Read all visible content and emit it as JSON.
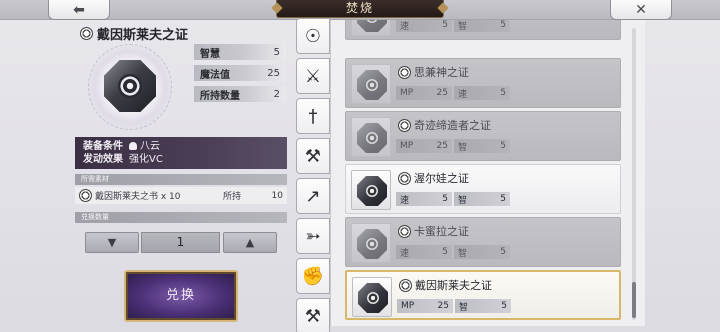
{
  "header": {
    "title": "焚烧",
    "back_icon": "back-arrow-icon",
    "close_icon": "close-x-icon"
  },
  "detail": {
    "item_name": "戴因斯莱夫之证",
    "stats": [
      {
        "label": "智慧",
        "value": "5"
      },
      {
        "label": "魔法值",
        "value": "25"
      },
      {
        "label": "所持数量",
        "value": "2"
      }
    ],
    "equip_condition_label": "装备条件",
    "equip_condition_value": "八云",
    "effect_label": "发动效果",
    "effect_value": "强化VC",
    "materials_header": "所需素材",
    "material_name": "戴因斯莱夫之书 x 10",
    "owned_label": "所持",
    "owned_count": "10",
    "exchange_qty_header": "兑换数量",
    "quantity": "1",
    "exchange_button": "兑换"
  },
  "tabs": [
    {
      "name": "accessory-tab",
      "icon": "ring-icon"
    },
    {
      "name": "sword-tab",
      "icon": "sword-icon"
    },
    {
      "name": "saber-tab",
      "icon": "saber-icon"
    },
    {
      "name": "axe-tab",
      "icon": "axe-icon"
    },
    {
      "name": "spear-tab",
      "icon": "spear-icon"
    },
    {
      "name": "bow-tab",
      "icon": "bow-icon"
    },
    {
      "name": "fist-tab",
      "icon": "fist-icon"
    },
    {
      "name": "hammer-tab",
      "icon": "hammer-icon"
    }
  ],
  "list": [
    {
      "name": "",
      "dim": true,
      "stats": [
        [
          "速",
          "5"
        ],
        [
          "智",
          "5"
        ]
      ]
    },
    {
      "name": "思兼神之证",
      "dim": true,
      "stats": [
        [
          "MP",
          "25"
        ],
        [
          "速",
          "5"
        ]
      ]
    },
    {
      "name": "奇迹缔造者之证",
      "dim": true,
      "stats": [
        [
          "MP",
          "25"
        ],
        [
          "智",
          "5"
        ]
      ]
    },
    {
      "name": "渥尔娃之证",
      "dim": false,
      "stats": [
        [
          "速",
          "5"
        ],
        [
          "智",
          "5"
        ]
      ]
    },
    {
      "name": "卡蜜拉之证",
      "dim": true,
      "stats": [
        [
          "速",
          "5"
        ],
        [
          "智",
          "5"
        ]
      ]
    },
    {
      "name": "戴因斯莱夫之证",
      "dim": false,
      "selected": true,
      "stats": [
        [
          "MP",
          "25"
        ],
        [
          "智",
          "5"
        ]
      ]
    }
  ]
}
